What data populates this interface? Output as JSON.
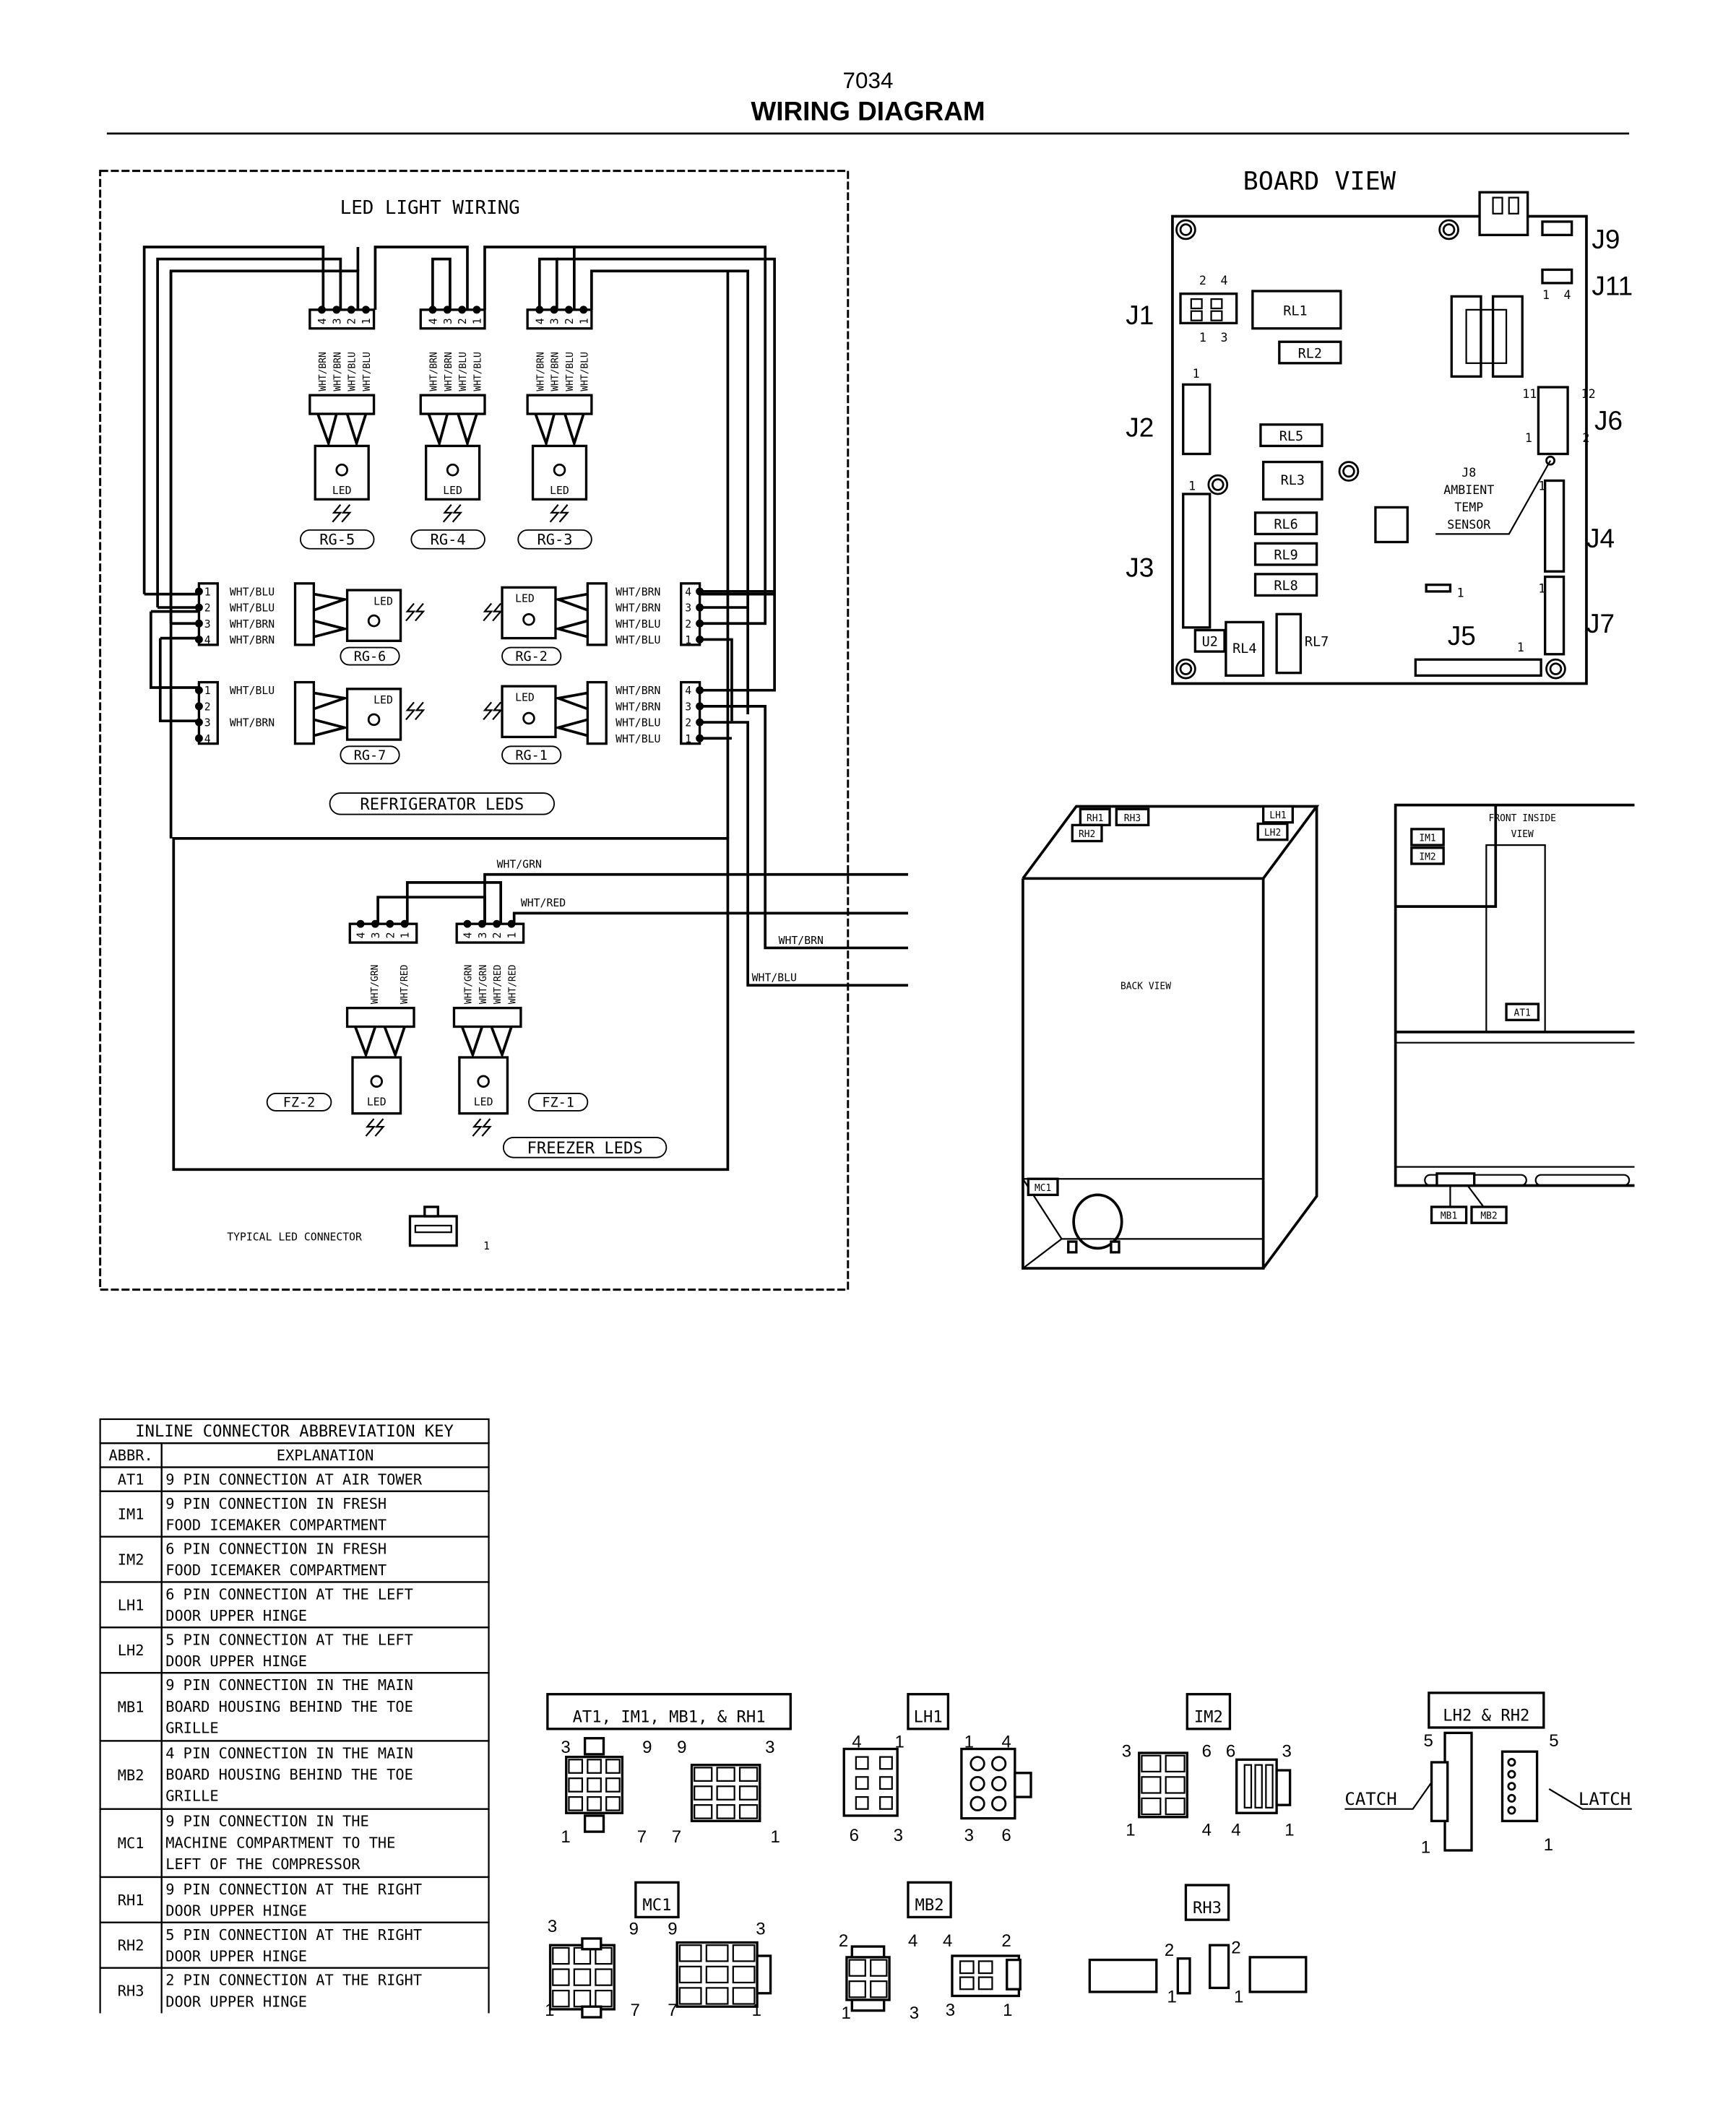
{
  "header": {
    "model": "7034",
    "title": "WIRING DIAGRAM"
  },
  "led_wiring": {
    "title": "LED LIGHT WIRING",
    "top_leds": [
      {
        "id": "RG-5",
        "wires": [
          "WHT/BRN",
          "WHT/BRN",
          "WHT/BLU",
          "WHT/BLU"
        ],
        "pins": [
          "4",
          "3",
          "2",
          "1"
        ]
      },
      {
        "id": "RG-4",
        "wires": [
          "WHT/BRN",
          "WHT/BRN",
          "WHT/BLU",
          "WHT/BLU"
        ],
        "pins": [
          "4",
          "3",
          "2",
          "1"
        ]
      },
      {
        "id": "RG-3",
        "wires": [
          "WHT/BRN",
          "WHT/BRN",
          "WHT/BLU",
          "WHT/BLU"
        ],
        "pins": [
          "4",
          "3",
          "2",
          "1"
        ]
      }
    ],
    "left_leds": [
      {
        "id": "RG-6",
        "pins": [
          "1",
          "2",
          "3",
          "4"
        ],
        "wires": [
          "WHT/BLU",
          "WHT/BLU",
          "WHT/BRN",
          "WHT/BRN"
        ]
      },
      {
        "id": "RG-7",
        "pins": [
          "1",
          "2",
          "3",
          "4"
        ],
        "wires": [
          "WHT/BLU",
          "",
          "WHT/BRN",
          ""
        ]
      }
    ],
    "right_leds": [
      {
        "id": "RG-2",
        "pins": [
          "4",
          "3",
          "2",
          "1"
        ],
        "wires": [
          "WHT/BRN",
          "WHT/BRN",
          "WHT/BLU",
          "WHT/BLU"
        ]
      },
      {
        "id": "RG-1",
        "pins": [
          "4",
          "3",
          "2",
          "1"
        ],
        "wires": [
          "WHT/BRN",
          "WHT/BRN",
          "WHT/BLU",
          "WHT/BLU"
        ]
      }
    ],
    "led_label": "LED",
    "refrigerator_label": "REFRIGERATOR LEDS",
    "freezer_label": "FREEZER LEDS",
    "freezer_leds": [
      {
        "id": "FZ-2",
        "pins": [
          "4",
          "3",
          "2",
          "1"
        ],
        "wires": [
          "WHT/GRN",
          "WHT/RED"
        ]
      },
      {
        "id": "FZ-1",
        "pins": [
          "4",
          "3",
          "2",
          "1"
        ],
        "wires": [
          "WHT/GRN",
          "WHT/GRN",
          "WHT/RED",
          "WHT/RED"
        ]
      }
    ],
    "out_wires": [
      "WHT/GRN",
      "WHT/RED",
      "WHT/BRN",
      "WHT/BLU"
    ],
    "typical_connector_label": "TYPICAL LED CONNECTOR",
    "typical_connector_pin": "1"
  },
  "board_view": {
    "title": "BOARD VIEW",
    "connectors": [
      "J1",
      "J2",
      "J3",
      "J4",
      "J5",
      "J6",
      "J7",
      "J9",
      "J11"
    ],
    "relays": [
      "RL1",
      "RL2",
      "RL5",
      "RL3",
      "RL6",
      "RL9",
      "RL8",
      "RL4",
      "RL7"
    ],
    "u2": "U2",
    "sensor_label": [
      "J8",
      "AMBIENT",
      "TEMP",
      "SENSOR"
    ],
    "pin_marks": {
      "j1_top": [
        "2",
        "4"
      ],
      "j1_bottom": [
        "1",
        "3"
      ],
      "j11": [
        "1",
        "4"
      ],
      "j6": [
        "11",
        "12",
        "1",
        "2"
      ],
      "one": "1"
    }
  },
  "back_view": {
    "label": "BACK VIEW",
    "tags": [
      "RH1",
      "RH3",
      "RH2",
      "LH1",
      "LH2",
      "MC1"
    ]
  },
  "front_view": {
    "label": [
      "FRONT INSIDE",
      "VIEW"
    ],
    "tags": [
      "IM1",
      "IM2",
      "AT1",
      "MB1",
      "MB2"
    ]
  },
  "abbreviation_key": {
    "title": "INLINE CONNECTOR ABBREVIATION KEY",
    "headers": [
      "ABBR.",
      "EXPLANATION"
    ],
    "rows": [
      {
        "abbr": "AT1",
        "lines": [
          "9 PIN CONNECTION AT AIR TOWER"
        ]
      },
      {
        "abbr": "IM1",
        "lines": [
          "9 PIN CONNECTION IN FRESH",
          "FOOD ICEMAKER COMPARTMENT"
        ]
      },
      {
        "abbr": "IM2",
        "lines": [
          "6 PIN CONNECTION IN FRESH",
          "FOOD ICEMAKER COMPARTMENT"
        ]
      },
      {
        "abbr": "LH1",
        "lines": [
          "6 PIN CONNECTION AT THE LEFT",
          "DOOR UPPER HINGE"
        ]
      },
      {
        "abbr": "LH2",
        "lines": [
          "5 PIN CONNECTION AT THE LEFT",
          "DOOR UPPER HINGE"
        ]
      },
      {
        "abbr": "MB1",
        "lines": [
          "9 PIN CONNECTION IN THE MAIN",
          "BOARD HOUSING BEHIND THE TOE",
          "GRILLE"
        ]
      },
      {
        "abbr": "MB2",
        "lines": [
          "4 PIN CONNECTION IN THE MAIN",
          "BOARD HOUSING BEHIND THE TOE",
          "GRILLE"
        ]
      },
      {
        "abbr": "MC1",
        "lines": [
          "9 PIN CONNECTION IN THE",
          "MACHINE COMPARTMENT TO THE",
          "LEFT OF THE COMPRESSOR"
        ]
      },
      {
        "abbr": "RH1",
        "lines": [
          "9 PIN CONNECTION AT THE RIGHT",
          "DOOR UPPER HINGE"
        ]
      },
      {
        "abbr": "RH2",
        "lines": [
          "5 PIN CONNECTION AT THE RIGHT",
          "DOOR UPPER HINGE"
        ]
      },
      {
        "abbr": "RH3",
        "lines": [
          "2 PIN CONNECTION AT THE RIGHT",
          "DOOR UPPER HINGE"
        ]
      }
    ]
  },
  "connector_views": [
    {
      "label": "AT1, IM1, MB1, & RH1",
      "pins": [
        "3",
        "9",
        "1",
        "7",
        "9",
        "3",
        "7",
        "1"
      ]
    },
    {
      "label": "LH1",
      "pins": [
        "4",
        "1",
        "6",
        "3",
        "1",
        "4",
        "3",
        "6"
      ]
    },
    {
      "label": "IM2",
      "pins": [
        "3",
        "6",
        "1",
        "4",
        "6",
        "3",
        "4",
        "1"
      ]
    },
    {
      "label": "LH2 & RH2",
      "pins": [
        "5",
        "1",
        "5",
        "1"
      ],
      "callouts": [
        "CATCH",
        "LATCH"
      ]
    },
    {
      "label": "MC1",
      "pins": [
        "3",
        "9",
        "1",
        "7",
        "9",
        "3",
        "7",
        "1"
      ]
    },
    {
      "label": "MB2",
      "pins": [
        "2",
        "4",
        "1",
        "3",
        "4",
        "2",
        "3",
        "1"
      ]
    },
    {
      "label": "RH3",
      "pins": [
        "2",
        "1",
        "2",
        "1"
      ]
    }
  ]
}
